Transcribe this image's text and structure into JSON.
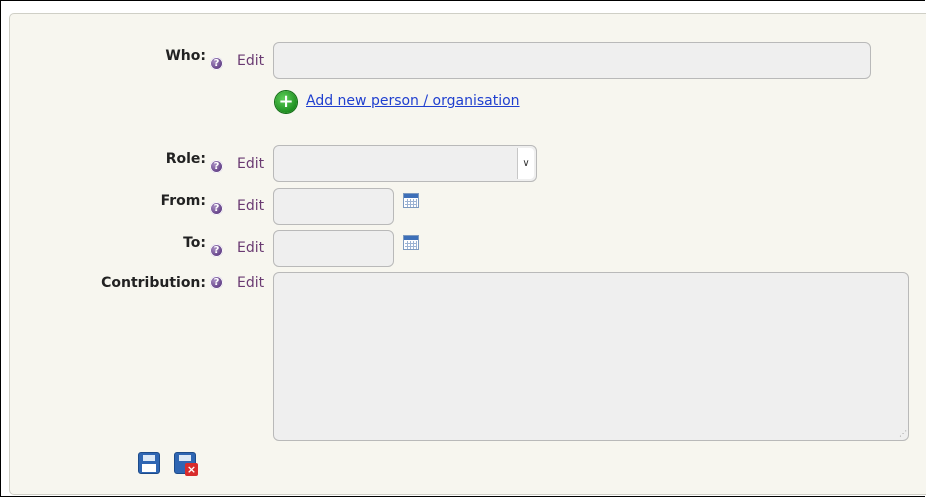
{
  "fields": {
    "who": {
      "label": "Who:",
      "edit": "Edit",
      "value": ""
    },
    "role": {
      "label": "Role:",
      "edit": "Edit",
      "value": ""
    },
    "from": {
      "label": "From:",
      "edit": "Edit",
      "value": ""
    },
    "to": {
      "label": "To:",
      "edit": "Edit",
      "value": ""
    },
    "contribution": {
      "label": "Contribution:",
      "edit": "Edit",
      "value": ""
    }
  },
  "add_new_link": "Add new person / organisation",
  "icons": {
    "help": "help-icon",
    "add": "plus-icon",
    "calendar": "calendar-icon",
    "save": "save-icon",
    "cancel": "cancel-icon"
  },
  "colors": {
    "panel_bg": "#f7f6ef",
    "edit_link": "#6a3a72",
    "add_link": "#1f3fcf"
  }
}
